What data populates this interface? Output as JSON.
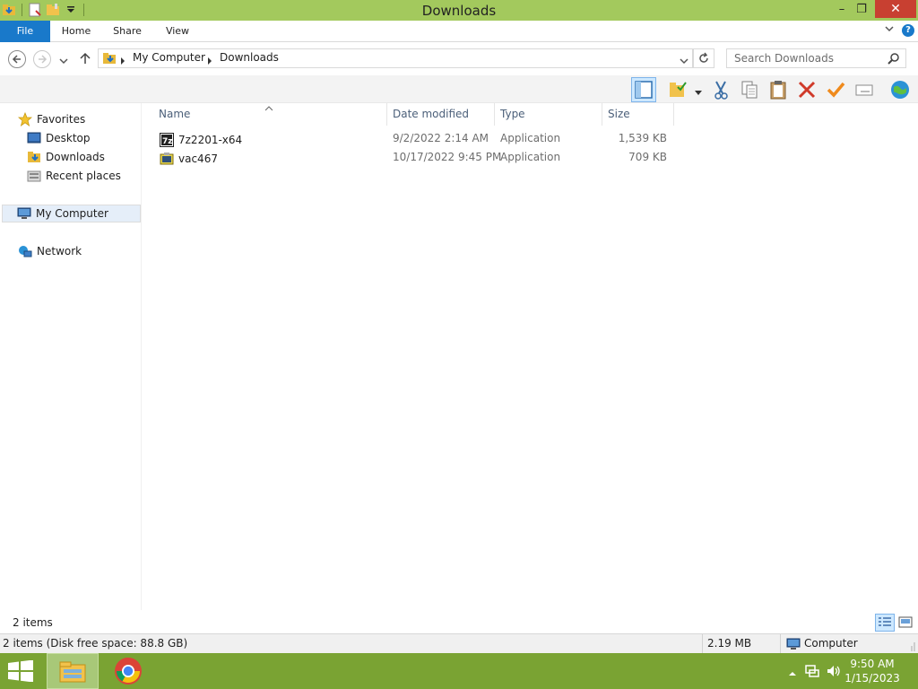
{
  "window": {
    "title": "Downloads",
    "minimize": "–",
    "restore": "❐",
    "close": "✕"
  },
  "ribbon": {
    "tabs": [
      "File",
      "Home",
      "Share",
      "View"
    ],
    "help": "?"
  },
  "address": {
    "crumbs": [
      "My Computer",
      "Downloads"
    ],
    "search_placeholder": "Search Downloads"
  },
  "nav": {
    "favorites": "Favorites",
    "desktop": "Desktop",
    "downloads": "Downloads",
    "recent": "Recent places",
    "computer": "My Computer",
    "network": "Network"
  },
  "columns": {
    "name": "Name",
    "date": "Date modified",
    "type": "Type",
    "size": "Size"
  },
  "files": [
    {
      "name": "7z2201-x64",
      "date": "9/2/2022 2:14 AM",
      "type": "Application",
      "size": "1,539 KB",
      "icon": "7zip-icon"
    },
    {
      "name": "vac467",
      "date": "10/17/2022 9:45 PM",
      "type": "Application",
      "size": "709 KB",
      "icon": "installer-icon"
    }
  ],
  "status": {
    "item_count": "2 items",
    "details": "2 items (Disk free space: 88.8 GB)",
    "size": "2.19 MB",
    "location": "Computer"
  },
  "taskbar": {
    "time": "9:50 AM",
    "date": "1/15/2023"
  },
  "colors": {
    "titlebar": "#a3c95d",
    "accent": "#1979ca",
    "taskbar": "#7aa333",
    "close": "#c84031"
  }
}
